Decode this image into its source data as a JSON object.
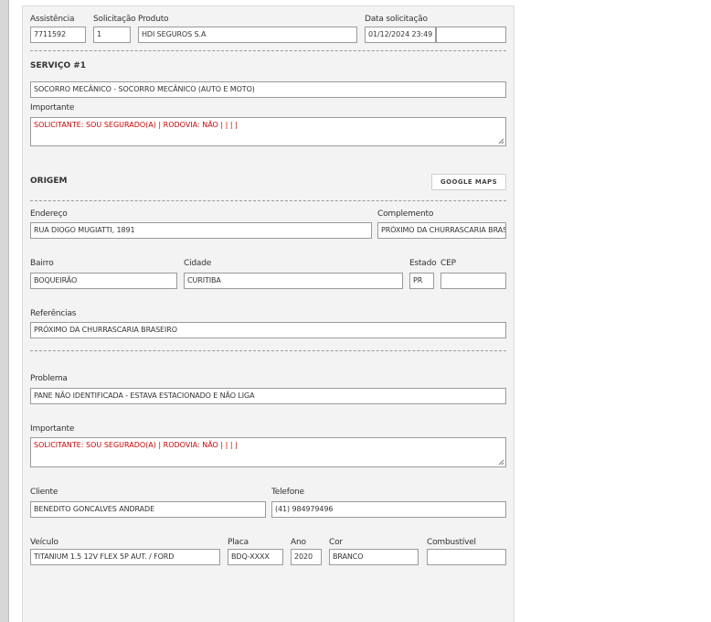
{
  "header": {
    "assistencia_label": "Assistência",
    "assistencia_value": "7711592",
    "solicitacao_label": "Solicitação",
    "solicitacao_value": "1",
    "produto_label": "Produto",
    "produto_value": "HDI SEGUROS S.A",
    "data_label": "Data solicitação",
    "data_value": "01/12/2024 23:49",
    "data_extra_value": ""
  },
  "servico": {
    "title": "SERVIÇO #1",
    "service_value": "SOCORRO MECÂNICO - SOCORRO MECÂNICO (AUTO E MOTO)",
    "importante_label": "Importante",
    "importante_value": "SOLICITANTE: SOU SEGURADO(A) | RODOVIA: NÃO |  |  |  |"
  },
  "origem": {
    "title": "ORIGEM",
    "maps_button": "GOOGLE MAPS",
    "endereco_label": "Endereço",
    "endereco_value": "RUA DIOGO MUGIATTI, 1891",
    "complemento_label": "Complemento",
    "complemento_value": "PRÓXIMO DA CHURRASCARIA BRASEIRO",
    "bairro_label": "Bairro",
    "bairro_value": "BOQUEIRÃO",
    "cidade_label": "Cidade",
    "cidade_value": "CURITIBA",
    "estado_label": "Estado",
    "estado_value": "PR",
    "cep_label": "CEP",
    "cep_value": "",
    "referencias_label": "Referências",
    "referencias_value": "PRÓXIMO DA CHURRASCARIA BRASEIRO"
  },
  "detalhes": {
    "problema_label": "Problema",
    "problema_value": "PANE NÃO IDENTIFICADA - ESTAVA ESTACIONADO E NÃO LIGA",
    "importante_label": "Importante",
    "importante_value": "SOLICITANTE: SOU SEGURADO(A) | RODOVIA: NÃO |  |  |  |",
    "cliente_label": "Cliente",
    "cliente_value": "BENEDITO GONCALVES ANDRADE",
    "telefone_label": "Telefone",
    "telefone_value": "(41) 984979496",
    "veiculo_label": "Veículo",
    "veiculo_value": "TITANIUM 1.5 12V FLEX 5P AUT. / FORD",
    "placa_label": "Placa",
    "placa_value": "BDQ-XXXX",
    "ano_label": "Ano",
    "ano_value": "2020",
    "cor_label": "Cor",
    "cor_value": "BRANCO",
    "combustivel_label": "Combustível",
    "combustivel_value": ""
  }
}
